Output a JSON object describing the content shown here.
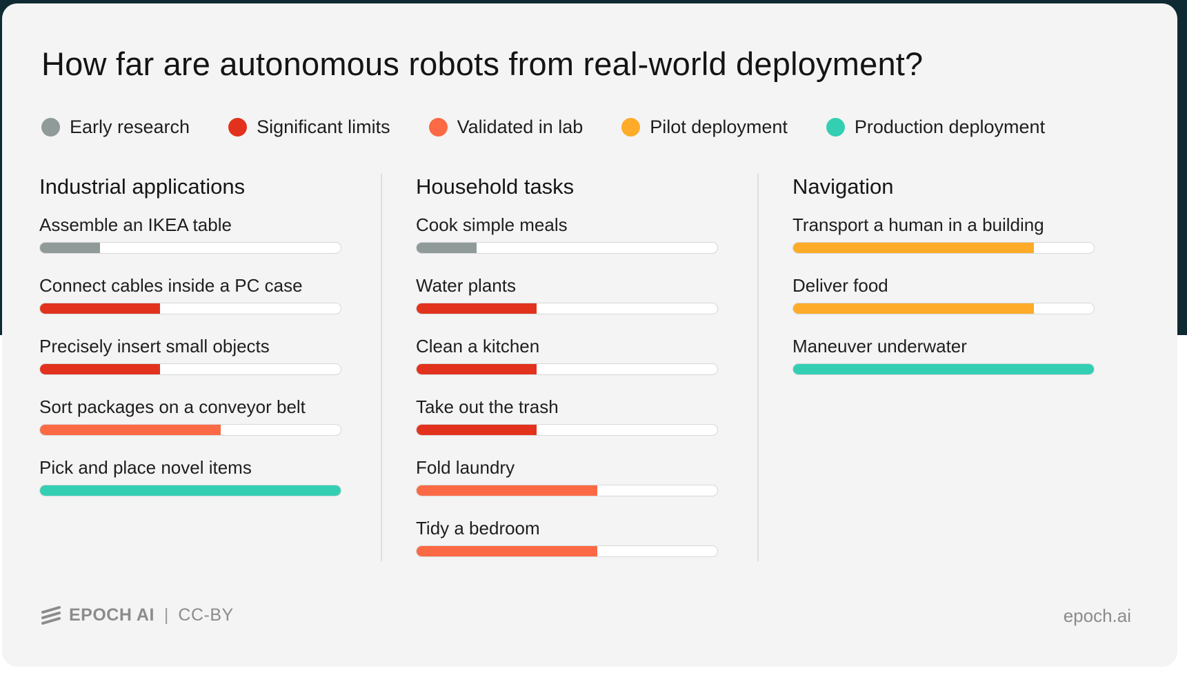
{
  "chart_data": {
    "type": "bar",
    "title": "How far are autonomous robots from real-world deployment?",
    "legend": {
      "placement": "top",
      "stages": [
        {
          "label": "Early research",
          "color": "#8f9a99"
        },
        {
          "label": "Significant limits",
          "color": "#e2321d"
        },
        {
          "label": "Validated in lab",
          "color": "#fb6a45"
        },
        {
          "label": "Pilot deployment",
          "color": "#fdab28"
        },
        {
          "label": "Production deployment",
          "color": "#34cfb3"
        }
      ]
    },
    "scale_max": 5,
    "groups": [
      {
        "name": "Industrial applications",
        "tasks": [
          {
            "label": "Assemble an IKEA table",
            "stage": 1
          },
          {
            "label": "Connect cables inside a PC case",
            "stage": 2
          },
          {
            "label": "Precisely insert small objects",
            "stage": 2
          },
          {
            "label": "Sort packages on a conveyor belt",
            "stage": 3
          },
          {
            "label": "Pick and place novel items",
            "stage": 5
          }
        ]
      },
      {
        "name": "Household tasks",
        "tasks": [
          {
            "label": "Cook simple meals",
            "stage": 1
          },
          {
            "label": "Water plants",
            "stage": 2
          },
          {
            "label": "Clean a kitchen",
            "stage": 2
          },
          {
            "label": "Take out the trash",
            "stage": 2
          },
          {
            "label": "Fold laundry",
            "stage": 3
          },
          {
            "label": "Tidy a bedroom",
            "stage": 3
          }
        ]
      },
      {
        "name": "Navigation",
        "tasks": [
          {
            "label": "Transport a human in a building",
            "stage": 4
          },
          {
            "label": "Deliver food",
            "stage": 4
          },
          {
            "label": "Maneuver underwater",
            "stage": 5
          }
        ]
      }
    ]
  },
  "footer": {
    "brand": "EPOCH AI",
    "separator": "|",
    "license": "CC-BY",
    "site": "epoch.ai"
  },
  "colors": {
    "background": "#f4f4f4",
    "track": "#ffffff"
  },
  "icons": {
    "logo": "epoch-logo-icon"
  }
}
